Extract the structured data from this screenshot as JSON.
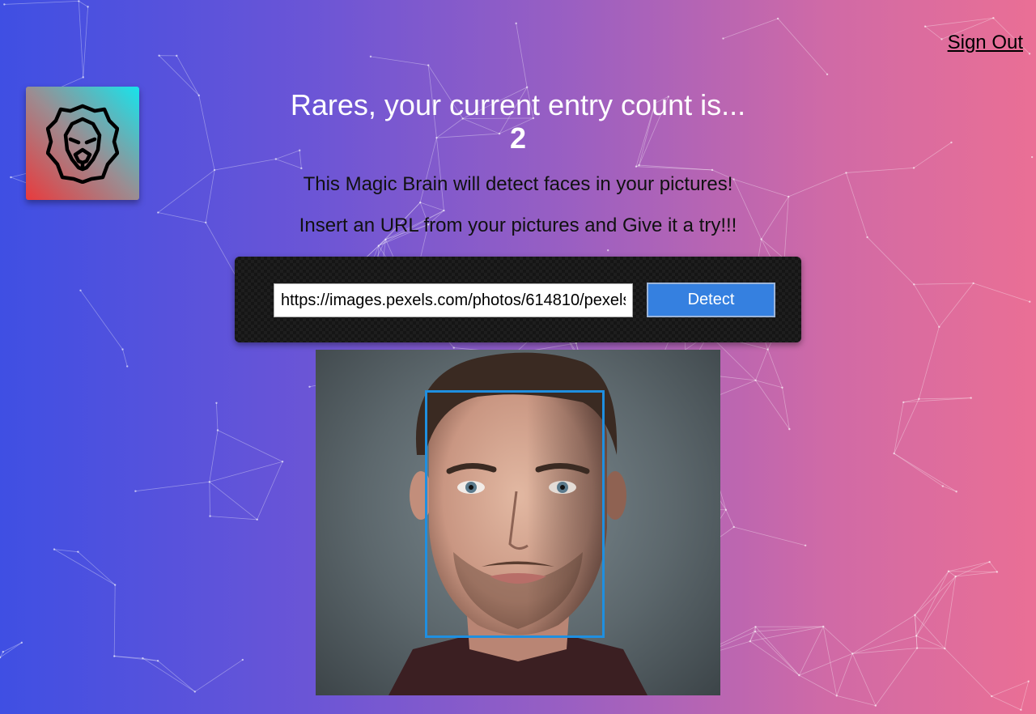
{
  "header": {
    "signout_label": "Sign Out"
  },
  "logo": {
    "icon": "lion-icon"
  },
  "rank": {
    "greeting": "Rares, your current entry count is...",
    "count": "2"
  },
  "intro": {
    "line1": "This Magic Brain will detect faces in your pictures!",
    "line2": "Insert an URL from your pictures and Give it a try!!!"
  },
  "form": {
    "url_value": "https://images.pexels.com/photos/614810/pexels",
    "button_label": "Detect"
  },
  "colors": {
    "gradient_start": "#3f4fe3",
    "gradient_end": "#ea6f95",
    "button": "#3580e0",
    "face_box": "#1f8fe0"
  }
}
